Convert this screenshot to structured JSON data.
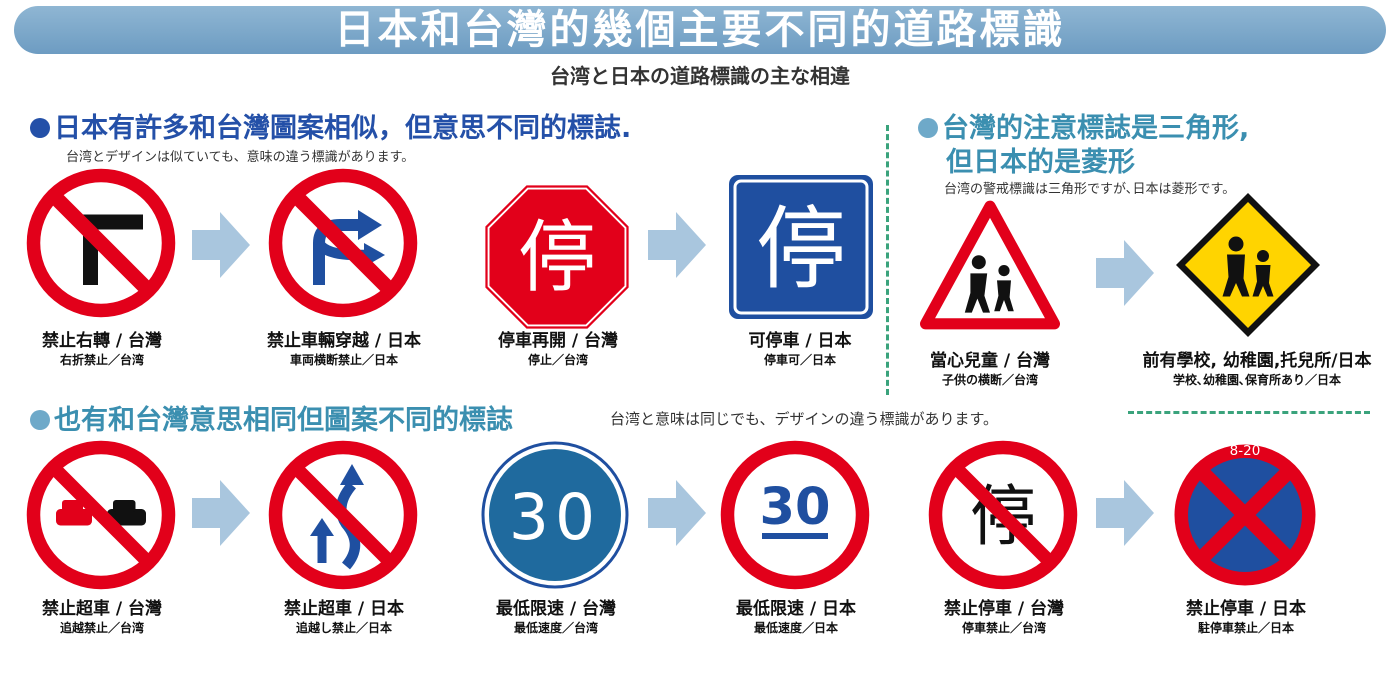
{
  "header": {
    "title": "日本和台灣的幾個主要不同的道路標識",
    "subtitle": "台湾と日本の道路標識の主な相違"
  },
  "section1": {
    "heading": "日本有許多和台灣圖案相似，但意思不同的標誌.",
    "note": "台湾とデザインは似ていても、意味の違う標識があります。"
  },
  "section2": {
    "heading_line1": "台灣的注意標誌是三角形,",
    "heading_line2": "但日本的是菱形",
    "note": "台湾の警戒標識は三角形ですが､日本は菱形です。"
  },
  "section3": {
    "heading": "也有和台灣意思相同但圖案不同的標誌",
    "note": "台湾と意味は同じでも、デザインの違う標識があります。"
  },
  "signs": {
    "no_right_turn_tw": {
      "caption": "禁止右轉 / 台灣",
      "sub": "右折禁止／台湾"
    },
    "no_crossing_jp": {
      "caption": "禁止車輛穿越 / 日本",
      "sub": "車両横断禁止／日本"
    },
    "stop_tw": {
      "caption": "停車再開 / 台灣",
      "sub": "停止／台湾",
      "glyph": "停"
    },
    "parking_ok_jp": {
      "caption": "可停車 / 日本",
      "sub": "停車可／日本",
      "glyph": "停"
    },
    "children_tw": {
      "caption": "當心兒童 / 台灣",
      "sub": "子供の横断／台湾"
    },
    "school_jp": {
      "caption": "前有學校, 幼稚園,托兒所/日本",
      "sub": "学校､幼稚園､保育所あり／日本"
    },
    "no_overtake_tw": {
      "caption": "禁止超車 / 台灣",
      "sub": "追越禁止／台湾"
    },
    "no_overtake_jp": {
      "caption": "禁止超車 / 日本",
      "sub": "追越し禁止／日本"
    },
    "min_speed_tw": {
      "caption": "最低限速 / 台灣",
      "sub": "最低速度／台湾",
      "value": "30"
    },
    "min_speed_jp": {
      "caption": "最低限速 / 日本",
      "sub": "最低速度／日本",
      "value": "30"
    },
    "no_stop_tw": {
      "caption": "禁止停車 / 台灣",
      "sub": "停車禁止／台湾",
      "glyph": "停"
    },
    "no_stop_jp": {
      "caption": "禁止停車 / 日本",
      "sub": "駐停車禁止／日本",
      "time": "8-20"
    }
  },
  "colors": {
    "banner": "#7aa6c8",
    "prohibition_red": "#e2001a",
    "sign_blue": "#1f4fa0",
    "heading_blue": "#2450a8",
    "heading_teal": "#3b8fb0",
    "arrow": "#a9c6de",
    "divider": "#3aa37c",
    "warning_yellow": "#ffd400"
  }
}
